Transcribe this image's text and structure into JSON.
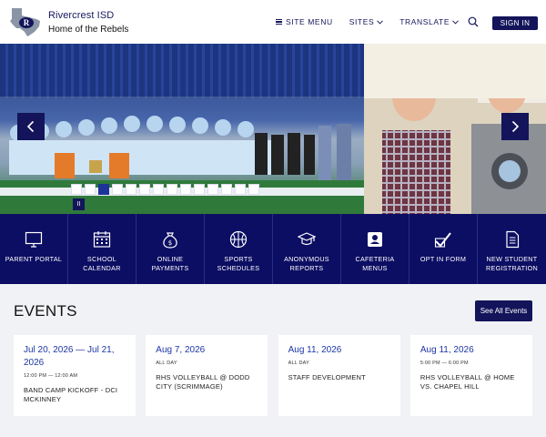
{
  "header": {
    "district_name": "Rivercrest ISD",
    "tagline": "Home of the Rebels",
    "nav": [
      {
        "label": "SITE MENU"
      },
      {
        "label": "SITES"
      },
      {
        "label": "TRANSLATE"
      }
    ],
    "sign_in_label": "SIGN IN"
  },
  "slideshow": {
    "slide_count": 14,
    "active_index": 2,
    "pause_label": "II"
  },
  "quick_links": [
    {
      "label": "PARENT PORTAL",
      "icon": "monitor-icon"
    },
    {
      "label": "SCHOOL CALENDAR",
      "icon": "calendar-icon"
    },
    {
      "label": "ONLINE PAYMENTS",
      "icon": "money-bag-icon"
    },
    {
      "label": "SPORTS SCHEDULES",
      "icon": "basketball-icon"
    },
    {
      "label": "ANONYMOUS REPORTS",
      "icon": "graduation-cap-icon"
    },
    {
      "label": "CAFETERIA MENUS",
      "icon": "cafeteria-icon"
    },
    {
      "label": "OPT IN FORM",
      "icon": "checkmark-form-icon"
    },
    {
      "label": "NEW STUDENT REGISTRATION",
      "icon": "document-icon"
    }
  ],
  "events": {
    "heading": "EVENTS",
    "see_all_label": "See All Events",
    "items": [
      {
        "date": "Jul 20, 2026 — Jul 21, 2026",
        "time": "12:00 PM — 12:00 AM",
        "title": "BAND CAMP KICKOFF - DCI MCKINNEY"
      },
      {
        "date": "Aug 7, 2026",
        "time": "ALL DAY",
        "title": "RHS VOLLEYBALL @ DODD CITY (SCRIMMAGE)"
      },
      {
        "date": "Aug 11, 2026",
        "time": "ALL DAY",
        "title": "STAFF DEVELOPMENT"
      },
      {
        "date": "Aug 11, 2026",
        "time": "5:00 PM — 6:00 PM",
        "title": "RHS VOLLEYBALL @ HOME VS. CHAPEL HILL"
      }
    ]
  },
  "colors": {
    "navy": "#13145a",
    "quick_bar": "#0c0e63",
    "event_date": "#1d36a6"
  }
}
